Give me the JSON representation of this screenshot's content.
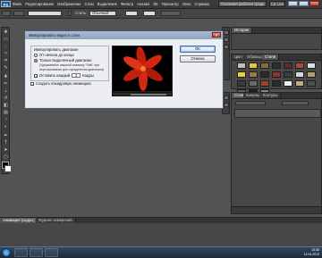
{
  "app": {
    "logo": "Ps"
  },
  "menu": [
    "Файл",
    "Редактирование",
    "Изображение",
    "Слои",
    "Выделение",
    "Фильтр",
    "Анализ",
    "3D",
    "Просмотр",
    "Окно",
    "Справка"
  ],
  "workspace_button": "Основная рабочая среда",
  "cs_live": "CS Live",
  "options_bar": {
    "label_style": "Стиль:",
    "style_value": "Обычный"
  },
  "panels": {
    "top_right_title": "История",
    "swatch_tabs": [
      "Цвет",
      "Образцы",
      "Стили"
    ],
    "layers_tabs": [
      "Слои",
      "Каналы",
      "Контуры"
    ]
  },
  "dialog": {
    "title": "Импортировать видео в слои",
    "group_label": "Импортировать диапазон",
    "option1": "От начала до конца",
    "option2": "Только выделенный диапазон",
    "option2_note": "(Удерживайте нажатой клавишу \"Shift\" при перетаскивании для определения диапазона)",
    "every_label": "Оставить каждый",
    "every_value": "2",
    "every_unit": "Кадры",
    "frame_anim": "Создать покадровую анимацию",
    "ok": "OK",
    "cancel": "Отмена"
  },
  "bottom_panel": {
    "tabs": [
      "Анимация (кадры)",
      "Журнал измерений"
    ]
  },
  "clock": {
    "time": "15:38",
    "date": "13.04.2013"
  },
  "colors": {
    "swatches": [
      "#bfbfbf",
      "#e1c83a",
      "#8a6a3b",
      "#303030",
      "#5e2a2a",
      "#b24a3a",
      "#e0e0e0",
      "#e8cc3c",
      "#9a7a4a",
      "#2b2b2b",
      "#8b3a2a",
      "#3d3d3d",
      "#d8d8d8",
      "#b5a070",
      "#3a3a3a",
      "#6a6a6a",
      "#a04030",
      "#2a2a2a",
      "#eeeeee",
      "#c0b080",
      "#505050",
      "#7a5a3a",
      "#1c1c1c",
      "#888888"
    ],
    "flower": "#d4260e"
  }
}
